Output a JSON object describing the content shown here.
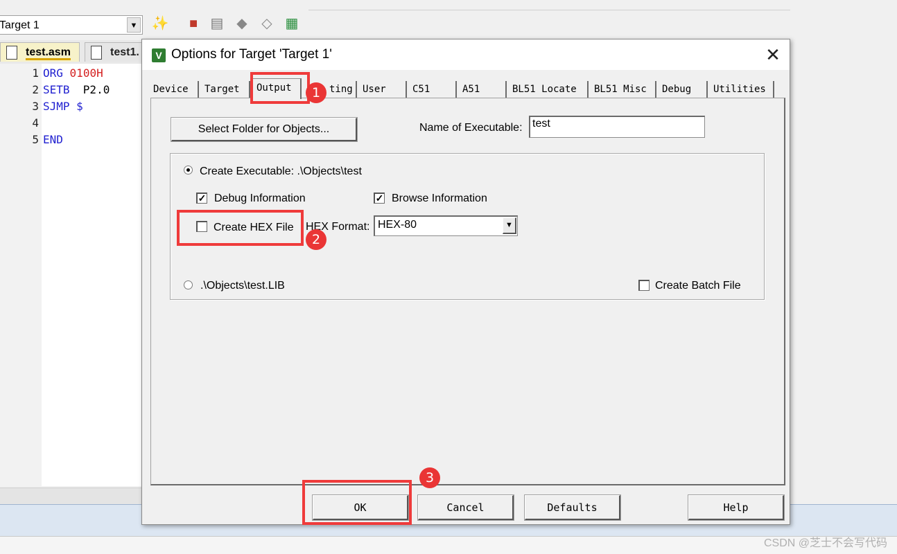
{
  "target_toolbar": {
    "target_name": "Target 1"
  },
  "file_tabs": [
    {
      "label": "test.asm",
      "active": true
    },
    {
      "label": "test1."
    }
  ],
  "editor": {
    "lines": [
      {
        "no": "1",
        "kw": "ORG",
        "arg": "0100H"
      },
      {
        "no": "2",
        "kw": "SETB",
        "arg": "P2.0"
      },
      {
        "no": "3",
        "kw": "SJMP",
        "arg": "$"
      },
      {
        "no": "4",
        "kw": "",
        "arg": ""
      },
      {
        "no": "5",
        "kw": "END",
        "arg": ""
      }
    ]
  },
  "dialog": {
    "title": "Options for Target 'Target 1'",
    "close_glyph": "✕",
    "app_icon": "V",
    "tabs": [
      "Device",
      "Target",
      "Output",
      "ting",
      "User",
      "C51",
      "A51",
      "BL51 Locate",
      "BL51 Misc",
      "Debug",
      "Utilities"
    ],
    "active_tab": "Output",
    "output": {
      "select_folder_label": "Select Folder for Objects...",
      "exe_name_label": "Name of Executable:",
      "exe_name_value": "test",
      "create_exe_label": "Create Executable:  .\\Objects\\test",
      "debug_info_label": "Debug Information",
      "browse_info_label": "Browse Information",
      "create_hex_label": "Create HEX File",
      "hex_format_label": "HEX Format:",
      "hex_format_value": "HEX-80",
      "lib_label": ".\\Objects\\test.LIB",
      "batch_label": "Create Batch File",
      "debug_info_checked": true,
      "browse_info_checked": true,
      "create_hex_checked": false,
      "batch_checked": false,
      "create_exe_selected": true
    },
    "buttons": {
      "ok": "OK",
      "cancel": "Cancel",
      "defaults": "Defaults",
      "help": "Help"
    }
  },
  "annotations": {
    "badge1": "1",
    "badge2": "2",
    "badge3": "3"
  },
  "watermark": "CSDN @芝士不会写代码",
  "colors": {
    "highlight": "#ef3b3b",
    "keyword": "#1f1fd0",
    "number": "#d42020"
  }
}
